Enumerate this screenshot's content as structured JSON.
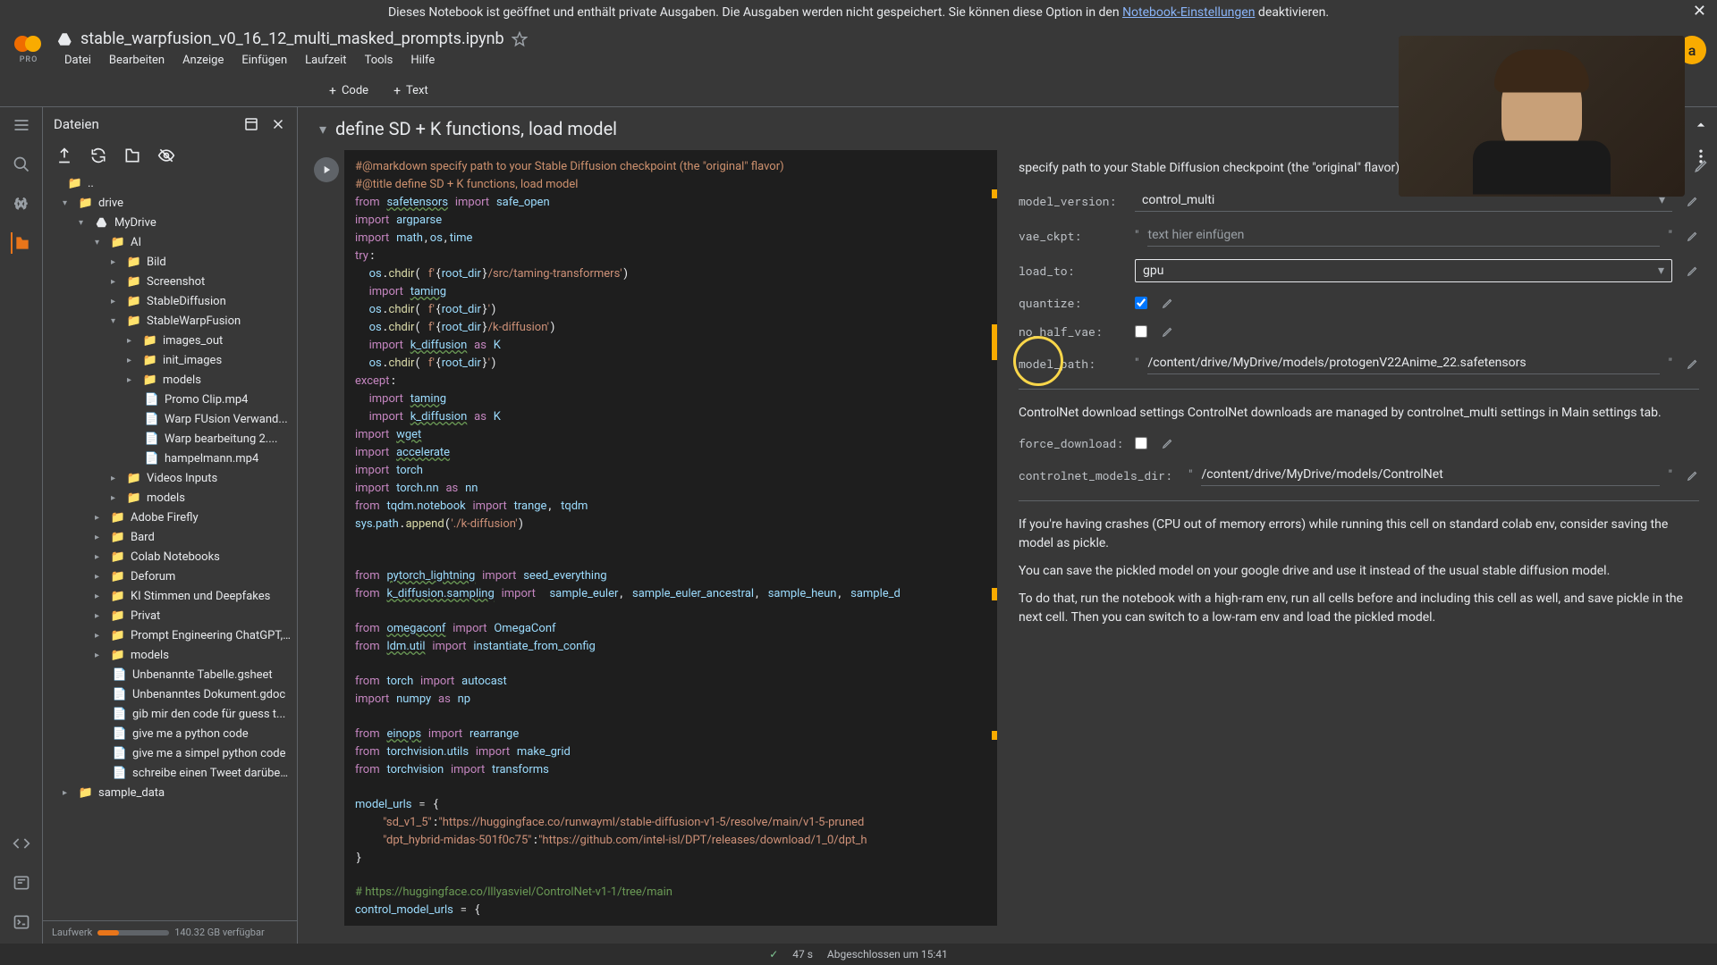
{
  "banner": {
    "text_pre": "Dieses Notebook ist geöffnet und enthält private Ausgaben. Die Ausgaben werden nicht gespeichert. Sie können diese Option in den ",
    "link": "Notebook-Einstellungen",
    "text_post": " deaktivieren."
  },
  "header": {
    "pro": "PRO",
    "title": "stable_warpfusion_v0_16_12_multi_masked_prompts.ipynb",
    "avatar_letter": "a"
  },
  "menu": [
    "Datei",
    "Bearbeiten",
    "Anzeige",
    "Einfügen",
    "Laufzeit",
    "Tools",
    "Hilfe"
  ],
  "toolbar": {
    "code": "Code",
    "text": "Text"
  },
  "files": {
    "title": "Dateien",
    "tree": {
      "root_up": "..",
      "drive": "drive",
      "mydrive": "MyDrive",
      "ai": "AI",
      "bild": "Bild",
      "screenshot": "Screenshot",
      "stablediffusion": "StableDiffusion",
      "stablewarpfusion": "StableWarpFusion",
      "images_out": "images_out",
      "init_images": "init_images",
      "models1": "models",
      "promo": "Promo Clip.mp4",
      "warpfusion": "Warp FUsion Verwand...",
      "warpbearbeit": "Warp bearbeitung 2....",
      "hampel": "hampelmann.mp4",
      "videos_inputs": "Videos Inputs",
      "models2": "models",
      "adobe": "Adobe Firefly",
      "bard": "Bard",
      "colab_nb": "Colab Notebooks",
      "deforum": "Deforum",
      "ki_stimmen": "KI Stimmen und Deepfakes",
      "privat": "Privat",
      "prompt_eng": "Prompt Engineering ChatGPT,...",
      "models3": "models",
      "unb_tab": "Unbenannte Tabelle.gsheet",
      "unb_dok": "Unbenanntes Dokument.gdoc",
      "gib_guess": "gib mir den code für guess t...",
      "give_python": "give me a python code",
      "give_simpel": "give me a simpel python code",
      "schreibe_tweet": "schreibe einen Tweet darüber ...",
      "sample_data": "sample_data"
    },
    "storage_label": "Laufwerk",
    "storage_free": "140.32 GB verfügbar"
  },
  "section": {
    "title": "define SD + K functions, load model"
  },
  "form": {
    "note": "specify path to your Stable Diffusion checkpoint (the \"original\" flavor)",
    "model_version_label": "model_version:",
    "model_version_value": "control_multi",
    "vae_ckpt_label": "vae_ckpt:",
    "vae_ckpt_placeholder": "text hier einfügen",
    "load_to_label": "load_to:",
    "load_to_value": "gpu",
    "quantize_label": "quantize:",
    "no_half_vae_label": "no_half_vae:",
    "model_path_label": "model_path:",
    "model_path_value": "/content/drive/MyDrive/models/protogenV22Anime_22.safetensors",
    "controlnet_text": "ControlNet download settings ControlNet downloads are managed by controlnet_multi settings in Main settings tab.",
    "force_download_label": "force_download:",
    "controlnet_dir_label": "controlnet_models_dir:",
    "controlnet_dir_value": "/content/drive/MyDrive/models/ControlNet",
    "crash_text1": "If you're having crashes (CPU out of memory errors) while running this cell on standard colab env, consider saving the model as pickle.",
    "crash_text2": "You can save the pickled model on your google drive and use it instead of the usual stable diffusion model.",
    "crash_text3": "To do that, run the notebook with a high-ram env, run all cells before and including this cell as well, and save pickle in the next cell. Then you can switch to a low-ram env and load the pickled model."
  },
  "status": {
    "time": "47 s",
    "done": "Abgeschlossen um 15:41"
  }
}
